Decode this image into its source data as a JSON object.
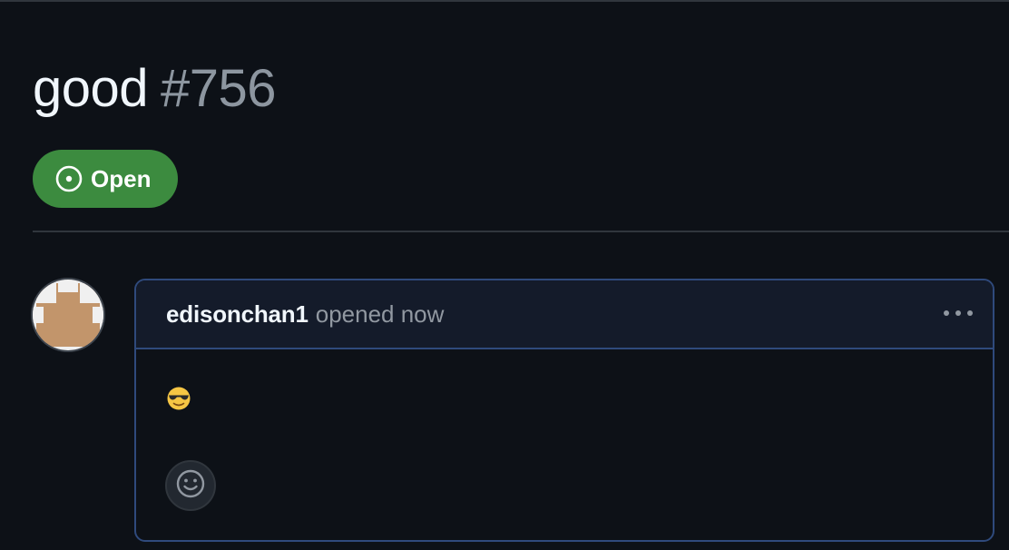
{
  "issue": {
    "title": "good",
    "number": "#756",
    "state": {
      "label": "Open",
      "icon": "issue-opened-icon",
      "color": "#3c8b3f"
    }
  },
  "comment": {
    "author": "edisonchan1",
    "action": "opened now",
    "body_emoji": "smiling-face-with-sunglasses",
    "menu_icon": "kebab-horizontal-icon",
    "reaction_icon": "smiley-icon"
  },
  "colors": {
    "background": "#0d1117",
    "comment_border": "#2f4a7c",
    "comment_header_bg": "#141b2a",
    "muted_text": "#8d96a0"
  }
}
